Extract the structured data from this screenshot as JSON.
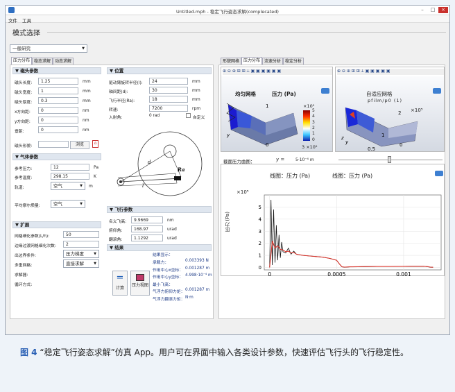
{
  "window": {
    "title": "Untitled.mph - 稳定飞行姿态求解(complecated)",
    "menu": [
      "文件",
      "工具"
    ]
  },
  "study": {
    "heading": "模式选择",
    "selected": "一般研究"
  },
  "left_tabs": [
    "压力分布",
    "稳态求解",
    "动态求解"
  ],
  "magnet_params": {
    "title": "磁头参数",
    "rows": [
      {
        "label": "磁头长度:",
        "value": "1.25",
        "unit": "mm"
      },
      {
        "label": "磁头宽度:",
        "value": "1",
        "unit": "mm"
      },
      {
        "label": "磁头厚度:",
        "value": "0.3",
        "unit": "mm"
      },
      {
        "label": "x方向距:",
        "value": "0",
        "unit": "nm"
      },
      {
        "label": "y方向距:",
        "value": "0",
        "unit": "nm"
      },
      {
        "label": "垂距:",
        "value": "0",
        "unit": "nm"
      }
    ],
    "shape_label": "磁头形貌:",
    "browse": "浏览"
  },
  "gas_params": {
    "title": "气体参数",
    "rows": [
      {
        "label": "参考压力:",
        "value": "12",
        "unit": "Pa"
      },
      {
        "label": "参考温度:",
        "value": "298.15",
        "unit": "K"
      }
    ],
    "gas_label": "轨道:",
    "gas_value": "空气",
    "gas_unit": "m",
    "model_label": "平均摩尔质量:",
    "model_value": "空气"
  },
  "expand": {
    "title": "扩展",
    "rows": [
      {
        "label": "网格细化参数(L/h):",
        "value": "50"
      },
      {
        "label": "边缘过渡网格细化次数:",
        "value": "2"
      }
    ],
    "selects": [
      {
        "label": "出边界条件:",
        "value": "压力梯度"
      },
      {
        "label": "多重网格:",
        "value": "直接求解"
      }
    ],
    "extra": [
      "求解器:",
      "循环方式:"
    ]
  },
  "position": {
    "title": "位置",
    "rows": [
      {
        "label": "驱动臂旋转半径(l):",
        "value": "24",
        "unit": "mm"
      },
      {
        "label": "轴间距(d):",
        "value": "30",
        "unit": "mm"
      },
      {
        "label": "飞行半径(Ra):",
        "value": "18",
        "unit": "mm"
      },
      {
        "label": "转速:",
        "value": "7200",
        "unit": "rpm"
      }
    ],
    "angle_label": "入射角:",
    "angle_value": "0 rad",
    "custom_label": "自定义",
    "diagram": {
      "d": "d",
      "l": "l",
      "Ra": "Ra"
    }
  },
  "flight": {
    "title": "飞行参数",
    "rows": [
      {
        "label": "名义飞高:",
        "value": "9.9669",
        "unit": "nm"
      },
      {
        "label": "俯仰角:",
        "value": "168.97",
        "unit": "urad"
      },
      {
        "label": "翻滚角:",
        "value": "1.1292",
        "unit": "urad"
      }
    ]
  },
  "results": {
    "title": "结果",
    "compute": "计算",
    "pressure_report": "压力视图",
    "header": "结果显示：",
    "rows": [
      {
        "label": "承载力：",
        "value": "0.003393 N"
      },
      {
        "label": "作用中心x坐标：",
        "value": "0.001287 m"
      },
      {
        "label": "作用中心y坐标：",
        "value": "4.998·10⁻⁴ m"
      },
      {
        "label": "最小飞高：",
        "value": ""
      },
      {
        "label": "气浮力俯仰力矩：",
        "value": "0.001287 m"
      },
      {
        "label": "气浮力翻滚力矩：",
        "value": "N·m"
      }
    ]
  },
  "right_tabs": [
    "形貌网格",
    "压力分布",
    "流速分析",
    "稳定分析"
  ],
  "plot_left": {
    "title1": "均匀网格",
    "title2": "压力 (Pa)",
    "colorbar": [
      "×10⁵",
      "5",
      "4",
      "3",
      "2",
      "1",
      "0",
      "3 ×10⁵"
    ],
    "labels": [
      "1",
      "y",
      "0"
    ]
  },
  "plot_right": {
    "title1": "自适应网格",
    "title2": "pfilm/p0 (1)",
    "exp": "×10⁵",
    "labels": [
      "2",
      "1",
      "0.5",
      "0",
      "z",
      "y"
    ]
  },
  "section": {
    "label": "截面压力曲图：",
    "var": "y =",
    "value": "5·10⁻⁴ m"
  },
  "line_plot": {
    "title_left": "线图：压力 (Pa)",
    "title_right": "线图：压力 (Pa)"
  },
  "chart_data": {
    "type": "line",
    "title": "线图：压力 (Pa)",
    "ylabel": "压力 (Pa)",
    "y_exponent": "×10⁵",
    "yticks": [
      "5",
      "4",
      "3",
      "2",
      "1",
      "0"
    ],
    "xticks": [
      "0",
      "0.0005",
      "0.001"
    ],
    "xlim": [
      -4e-05,
      0.00128
    ],
    "ylim": [
      -0.2,
      6
    ],
    "series": [
      {
        "color": "#111111",
        "x": [
          0,
          1e-05,
          2e-05,
          3e-05,
          4e-05,
          5e-05,
          6e-05,
          7e-05,
          8e-05,
          9e-05,
          0.0001,
          0.00012,
          0.00014,
          0.00016,
          0.00018,
          0.0002,
          0.00025,
          0.0003,
          0.00035,
          0.0004,
          0.00045,
          0.0005,
          0.00052,
          0.00054,
          0.00056,
          0.0006,
          0.0007,
          0.0008,
          0.0009,
          0.001,
          0.00105,
          0.0011,
          0.00115,
          0.00118,
          0.0012,
          0.00122
        ],
        "y": [
          0,
          5.6,
          0.2,
          4.8,
          0.4,
          3.5,
          0.6,
          2.7,
          0.8,
          2.1,
          1.3,
          1.2,
          1.6,
          1.1,
          1.35,
          1.1,
          1.0,
          0.95,
          0.9,
          0.85,
          0.75,
          0.6,
          0.3,
          0.05,
          0.02,
          0.05,
          0.07,
          0.08,
          0.08,
          0.09,
          0.1,
          0.1,
          0.1,
          0.06,
          0.02,
          0.02
        ]
      },
      {
        "color": "#d9342b",
        "x": [
          0,
          2e-05,
          4e-05,
          6e-05,
          8e-05,
          0.0001,
          0.00012,
          0.00014,
          0.00016,
          0.00018,
          0.0002,
          0.00025,
          0.0003,
          0.00035,
          0.0004,
          0.00045,
          0.0005,
          0.00052,
          0.00054,
          0.00056,
          0.0006,
          0.0007,
          0.0008,
          0.0009,
          0.001,
          0.00105,
          0.0011,
          0.00115,
          0.00118,
          0.0012,
          0.00122
        ],
        "y": [
          0,
          2.2,
          1.6,
          1.8,
          1.5,
          1.45,
          1.3,
          1.35,
          1.2,
          1.25,
          1.1,
          1.0,
          0.95,
          0.9,
          0.85,
          0.75,
          0.6,
          0.3,
          0.06,
          0.03,
          0.05,
          0.07,
          0.08,
          0.08,
          0.09,
          0.1,
          0.1,
          0.1,
          0.07,
          0.03,
          0.02
        ]
      }
    ]
  },
  "caption": {
    "label": "图 4",
    "text": "“稳定飞行姿态求解”仿真 App。用户可在界面中输入各类设计参数，快速评估飞行头的飞行稳定性。"
  }
}
